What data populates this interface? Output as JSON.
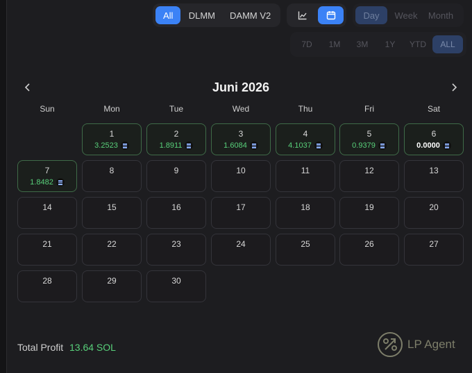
{
  "pool_filter": {
    "options": [
      "All",
      "DLMM",
      "DAMM V2"
    ],
    "active": "All"
  },
  "view_toggle": {
    "icons": [
      "line-chart-icon",
      "calendar-icon"
    ],
    "active": "calendar-icon"
  },
  "period_filter": {
    "options": [
      "Day",
      "Week",
      "Month"
    ],
    "active": "Day"
  },
  "range_filter": {
    "options": [
      "7D",
      "1M",
      "3M",
      "1Y",
      "YTD",
      "ALL"
    ],
    "active": "ALL"
  },
  "calendar": {
    "title": "Juni 2026",
    "weekdays": [
      "Sun",
      "Mon",
      "Tue",
      "Wed",
      "Thu",
      "Fri",
      "Sat"
    ],
    "days": [
      {
        "day": "1",
        "value": "3.2523"
      },
      {
        "day": "2",
        "value": "1.8911"
      },
      {
        "day": "3",
        "value": "1.6084"
      },
      {
        "day": "4",
        "value": "4.1037"
      },
      {
        "day": "5",
        "value": "0.9379"
      },
      {
        "day": "6",
        "value": "0.0000"
      },
      {
        "day": "7",
        "value": "1.8482"
      },
      {
        "day": "8"
      },
      {
        "day": "9"
      },
      {
        "day": "10"
      },
      {
        "day": "11"
      },
      {
        "day": "12"
      },
      {
        "day": "13"
      },
      {
        "day": "14"
      },
      {
        "day": "15"
      },
      {
        "day": "16"
      },
      {
        "day": "17"
      },
      {
        "day": "18"
      },
      {
        "day": "19"
      },
      {
        "day": "20"
      },
      {
        "day": "21"
      },
      {
        "day": "22"
      },
      {
        "day": "23"
      },
      {
        "day": "24"
      },
      {
        "day": "25"
      },
      {
        "day": "26"
      },
      {
        "day": "27"
      },
      {
        "day": "28"
      },
      {
        "day": "29"
      },
      {
        "day": "30"
      }
    ]
  },
  "footer": {
    "total_label": "Total Profit",
    "total_value": "13.64 SOL",
    "brand": "LP Agent"
  },
  "colors": {
    "accent": "#3b82f6",
    "profit": "#58d07a",
    "profit_border": "#3f6b48"
  }
}
